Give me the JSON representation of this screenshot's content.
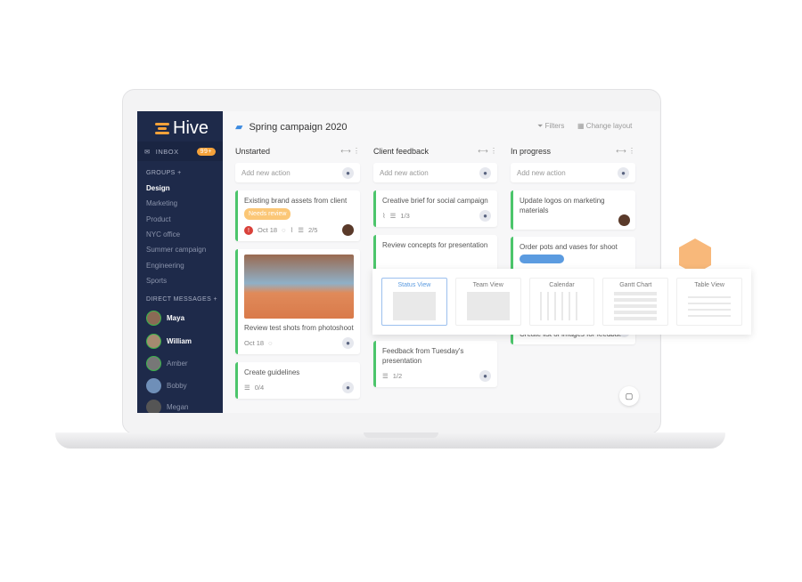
{
  "app": {
    "name": "Hive",
    "accent": "#f5a23a",
    "sidebar_bg": "#1e2a4a",
    "status_green": "#4cc56b"
  },
  "sidebar": {
    "inbox": {
      "label": "INBOX",
      "badge": "99+"
    },
    "groups_label": "GROUPS",
    "groups": [
      "Design",
      "Marketing",
      "Product",
      "NYC office",
      "Summer campaign",
      "Engineering",
      "Sports"
    ],
    "dm_label": "DIRECT MESSAGES",
    "dms": [
      "Maya",
      "William",
      "Amber",
      "Bobby",
      "Megan"
    ]
  },
  "header": {
    "title": "Spring campaign 2020",
    "filters": "Filters",
    "change_layout": "Change layout"
  },
  "columns": [
    {
      "title": "Unstarted",
      "add": "Add new action",
      "cards": [
        {
          "title": "Existing brand assets from client",
          "tag": "Needs review",
          "date": "Oct 18",
          "checklist": "2/5"
        },
        {
          "title": "Review test shots from photoshoot",
          "date": "Oct 18"
        },
        {
          "title": "Create guidelines",
          "checklist": "0/4"
        }
      ]
    },
    {
      "title": "Client feedback",
      "add": "Add new action",
      "cards": [
        {
          "title": "Creative brief for social campaign",
          "checklist": "1/3"
        },
        {
          "title": "Review concepts for presentation"
        },
        {
          "title": "Feedback from Tuesday's presentation",
          "checklist": "1/2"
        }
      ]
    },
    {
      "title": "In progress",
      "add": "Add new action",
      "cards": [
        {
          "title": "Update logos on marketing materials"
        },
        {
          "title": "Order pots and vases for shoot"
        },
        {
          "title": "Create list of images for feedback"
        }
      ]
    }
  ],
  "views": [
    "Status View",
    "Team View",
    "Calendar",
    "Gantt Chart",
    "Table View"
  ],
  "selected_view": "Status View"
}
